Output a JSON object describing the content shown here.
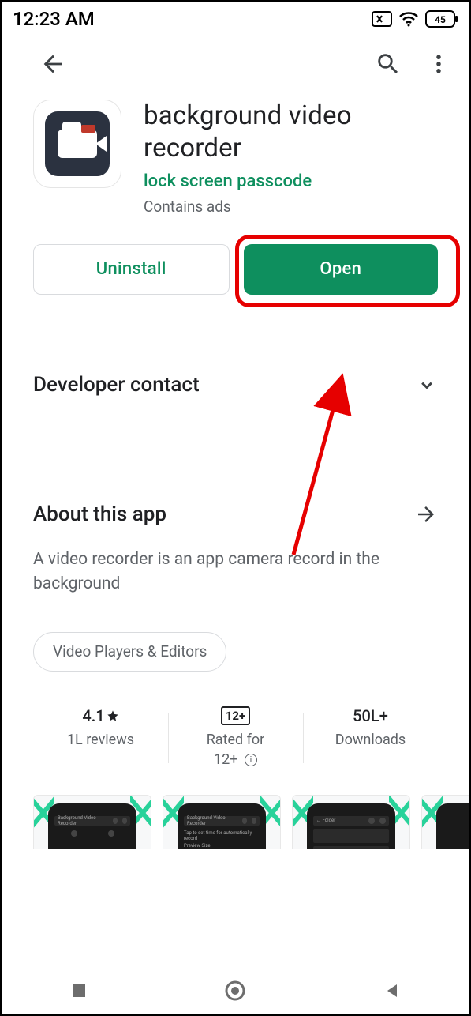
{
  "status": {
    "time": "12:23 AM",
    "battery": "45"
  },
  "app": {
    "title": "background video recorder",
    "developer": "lock screen passcode",
    "contains_ads": "Contains ads"
  },
  "actions": {
    "uninstall": "Uninstall",
    "open": "Open"
  },
  "sections": {
    "developer_contact": "Developer contact",
    "about_title": "About this app",
    "about_desc": "A video recorder is an app camera record in the background",
    "category_chip": "Video Players & Editors"
  },
  "stats": {
    "rating_value": "4.1",
    "rating_label": "1L reviews",
    "age_badge": "12+",
    "age_line1": "Rated for",
    "age_line2": "12+",
    "downloads_value": "50L+",
    "downloads_label": "Downloads"
  }
}
